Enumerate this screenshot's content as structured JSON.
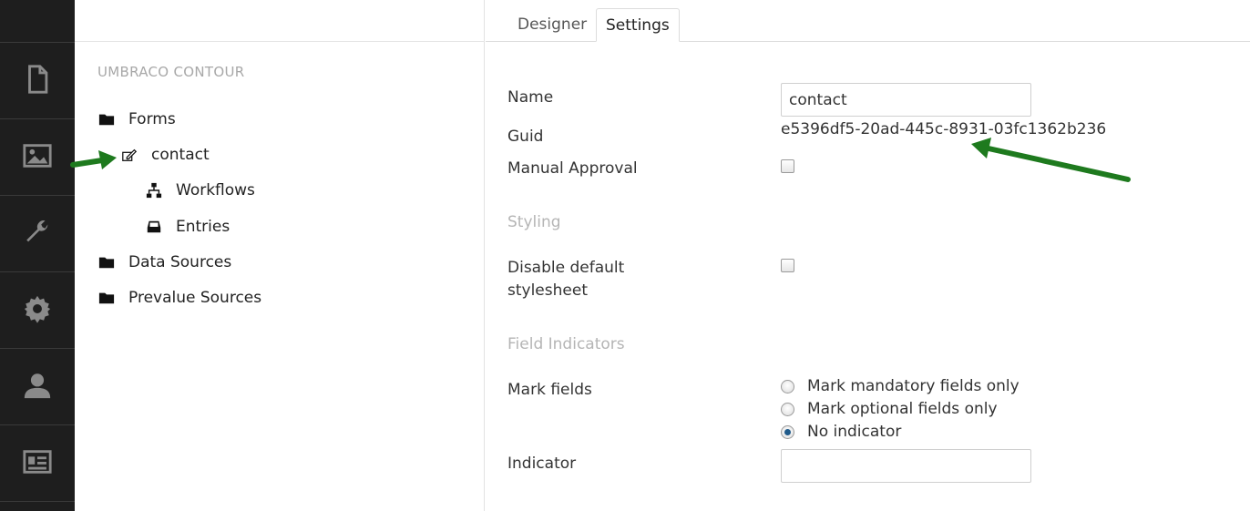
{
  "rail": {
    "items": [
      {
        "name": "content-section",
        "icon": "document-icon"
      },
      {
        "name": "media-section",
        "icon": "image-icon"
      },
      {
        "name": "developer-section",
        "icon": "wrench-icon"
      },
      {
        "name": "settings-section",
        "icon": "gear-icon"
      },
      {
        "name": "users-section",
        "icon": "user-icon"
      },
      {
        "name": "members-section",
        "icon": "id-card-icon"
      }
    ]
  },
  "tree": {
    "title": "UMBRACO CONTOUR",
    "nodes": {
      "forms": "Forms",
      "contact": "contact",
      "workflows": "Workflows",
      "entries": "Entries",
      "data_sources": "Data Sources",
      "prevalue_sources": "Prevalue Sources"
    }
  },
  "tabs": {
    "designer": "Designer",
    "settings": "Settings",
    "active": "Settings"
  },
  "settings": {
    "name_label": "Name",
    "name_value": "contact",
    "guid_label": "Guid",
    "guid_value": "e5396df5-20ad-445c-8931-03fc1362b236",
    "manual_approval_label": "Manual Approval",
    "manual_approval_checked": false,
    "styling_heading": "Styling",
    "disable_stylesheet_label_line1": "Disable default",
    "disable_stylesheet_label_line2": "stylesheet",
    "disable_stylesheet_checked": false,
    "field_indicators_heading": "Field Indicators",
    "mark_fields_label": "Mark fields",
    "mark_options": [
      {
        "label": "Mark mandatory fields only",
        "selected": false
      },
      {
        "label": "Mark optional fields only",
        "selected": false
      },
      {
        "label": "No indicator",
        "selected": true
      }
    ],
    "indicator_label": "Indicator",
    "indicator_value": ""
  },
  "colors": {
    "rail_bg": "#1e1e1e",
    "rail_icon": "#8a8a8a",
    "section_heading": "#b5b5b5",
    "annotation_arrow": "#1e7a1e"
  }
}
